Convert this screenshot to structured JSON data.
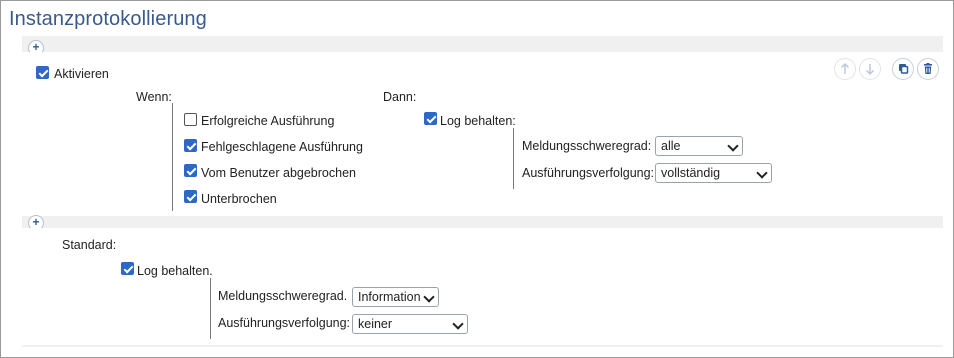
{
  "page": {
    "title": "Instanzprotokollierung"
  },
  "rule": {
    "enable_label": "Aktivieren",
    "enable_checked": true,
    "when_label": "Wenn:",
    "then_label": "Dann:",
    "conditions": [
      {
        "label": "Erfolgreiche Ausführung",
        "checked": false
      },
      {
        "label": "Fehlgeschlagene Ausführung",
        "checked": true
      },
      {
        "label": "Vom Benutzer abgebrochen",
        "checked": true
      },
      {
        "label": "Unterbrochen",
        "checked": true
      }
    ],
    "keep_log_label": "Log behalten:",
    "keep_log_checked": true,
    "severity_label": "Meldungsschweregrad:",
    "severity_value": "alle",
    "trace_label": "Ausführungsverfolgung:",
    "trace_value": "vollständig"
  },
  "toolbar": {
    "icons": [
      "arrow-up-icon",
      "arrow-down-icon",
      "duplicate-icon",
      "delete-icon"
    ]
  },
  "default": {
    "label": "Standard:",
    "keep_log_label": "Log behalten.",
    "keep_log_checked": true,
    "severity_label": "Meldungsschweregrad.",
    "severity_value": "Information",
    "trace_label": "Ausführungsverfolgung:",
    "trace_value": "keiner"
  },
  "colors": {
    "title": "#3a5a8c",
    "accent": "#2f67c4",
    "panel_bg": "#f0f0f0"
  }
}
